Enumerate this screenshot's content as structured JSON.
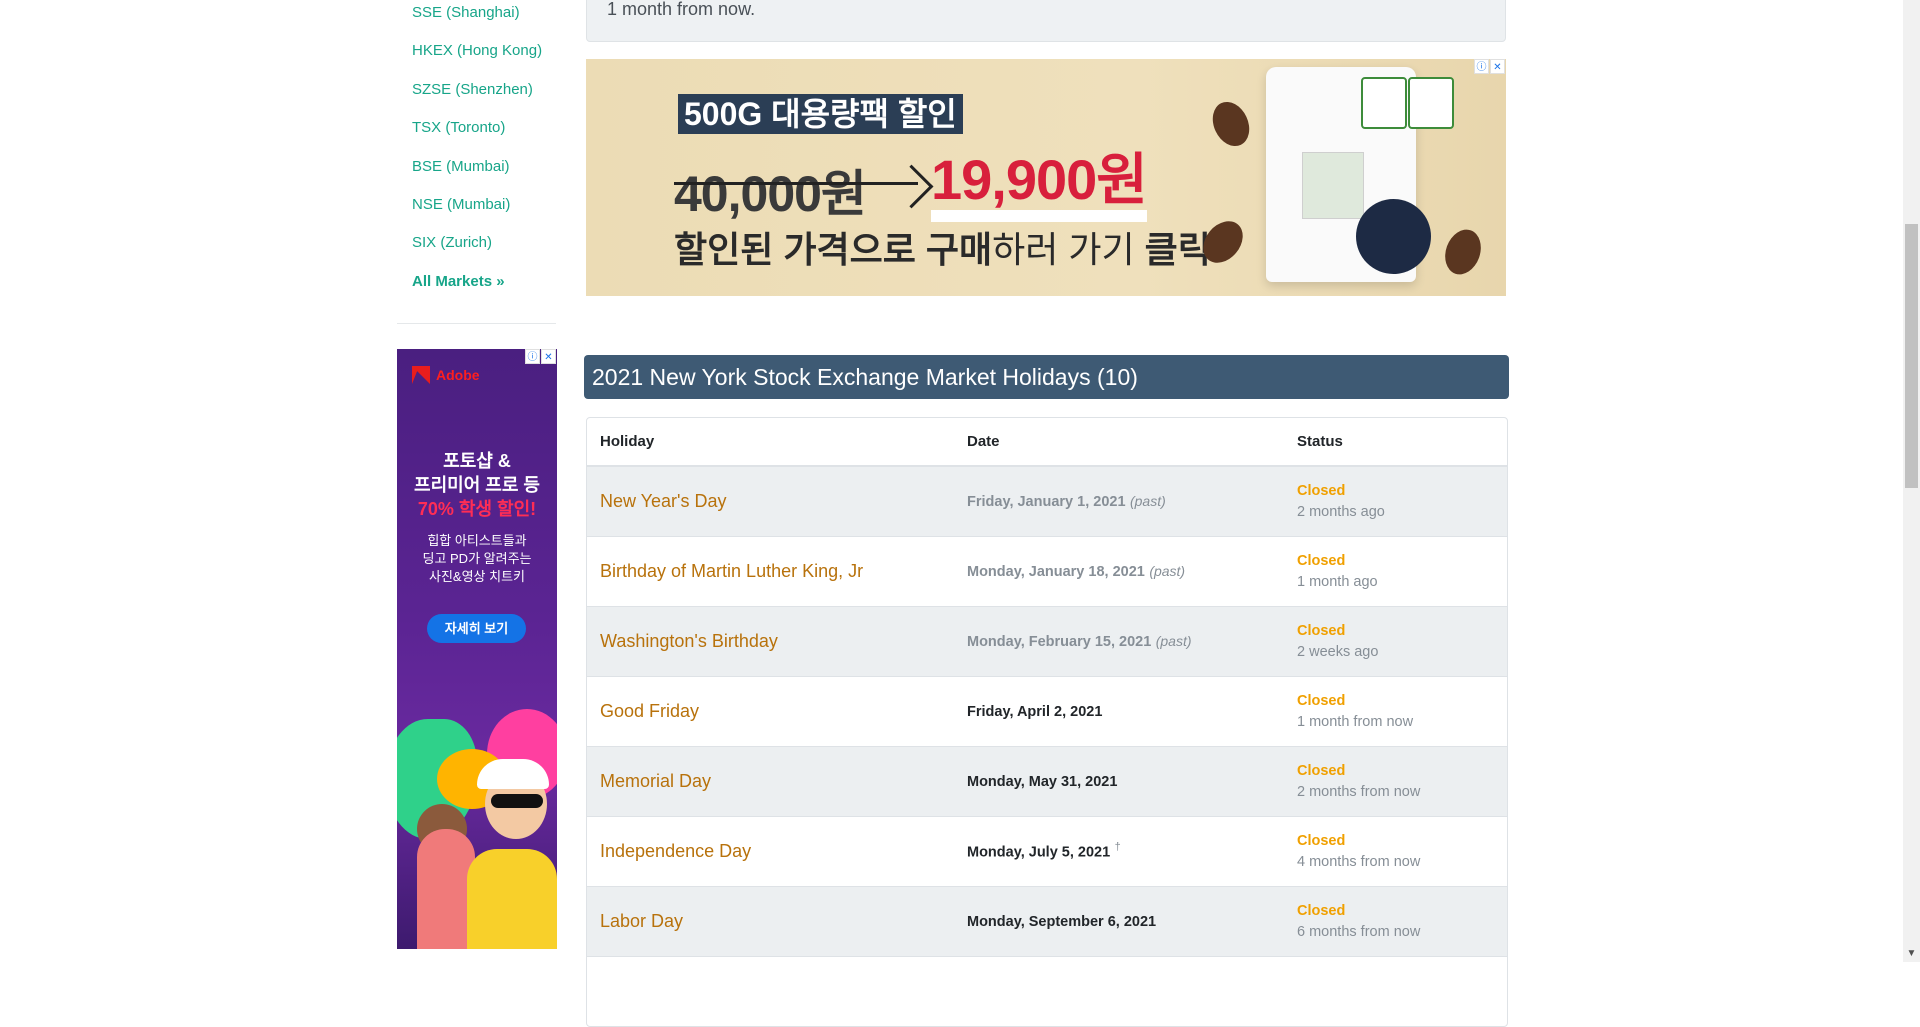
{
  "sidebar": {
    "markets": [
      {
        "label": "SSE (Shanghai)"
      },
      {
        "label": "HKEX (Hong Kong)"
      },
      {
        "label": "SZSE (Shenzhen)"
      },
      {
        "label": "TSX (Toronto)"
      },
      {
        "label": "BSE (Mumbai)"
      },
      {
        "label": "NSE (Mumbai)"
      },
      {
        "label": "SIX (Zurich)"
      }
    ],
    "all_markets_label": "All Markets »",
    "ad": {
      "brand": "Adobe",
      "headline_1": "포토샵 &",
      "headline_2": "프리미어 프로 등",
      "headline_3": "70% 학생 할인!",
      "body_1": "힙합 아티스트들과",
      "body_2": "딩고 PD가 알려주는",
      "body_3": "사진&영상 치트키",
      "cta": "자세히 보기"
    }
  },
  "previous_box": {
    "text": "1 month from now."
  },
  "top_ad": {
    "tag": "500G 대용량팩 할인",
    "old_price": "40,000원",
    "new_price": "19,900원",
    "sub_bold_1": "할인된 가격으로 구매",
    "sub_light": "하러 가기 ",
    "sub_bold_2": "클릭",
    "sub_end": "!"
  },
  "ad_badges": {
    "info": "ⓘ",
    "close": "✕"
  },
  "holidays_section": {
    "title": "2021 New York Stock Exchange Market Holidays (10)",
    "columns": {
      "holiday": "Holiday",
      "date": "Date",
      "status": "Status"
    },
    "rows": [
      {
        "name": "New Year's Day",
        "date": "Friday, January 1, 2021",
        "note": "(past)",
        "status": "Closed",
        "relative": "2 months ago",
        "past": true
      },
      {
        "name": "Birthday of Martin Luther King, Jr",
        "date": "Monday, January 18, 2021",
        "note": "(past)",
        "status": "Closed",
        "relative": "1 month ago",
        "past": true
      },
      {
        "name": "Washington's Birthday",
        "date": "Monday, February 15, 2021",
        "note": "(past)",
        "status": "Closed",
        "relative": "2 weeks ago",
        "past": true
      },
      {
        "name": "Good Friday",
        "date": "Friday, April 2, 2021",
        "note": "",
        "status": "Closed",
        "relative": "1 month from now",
        "past": false
      },
      {
        "name": "Memorial Day",
        "date": "Monday, May 31, 2021",
        "note": "",
        "status": "Closed",
        "relative": "2 months from now",
        "past": false
      },
      {
        "name": "Independence Day",
        "date": "Monday, July 5, 2021",
        "note": "†",
        "status": "Closed",
        "relative": "4 months from now",
        "past": false
      },
      {
        "name": "Labor Day",
        "date": "Monday, September 6, 2021",
        "note": "",
        "status": "Closed",
        "relative": "6 months from now",
        "past": false
      }
    ]
  },
  "colors": {
    "link": "#17a589",
    "header_bg": "#3e5a74",
    "holiday_name": "#b8720c",
    "status_closed": "#f0a000",
    "muted": "#868e96"
  }
}
